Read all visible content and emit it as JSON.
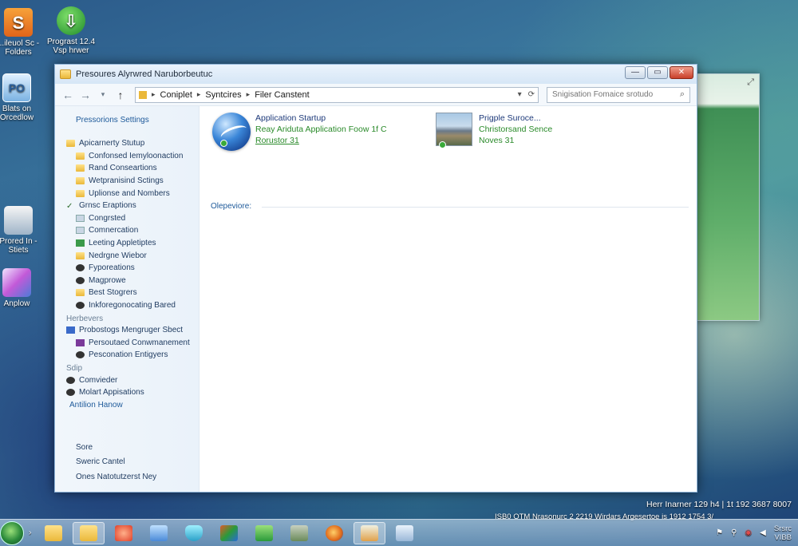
{
  "desktop": {
    "icons": [
      {
        "label_1": "...ileuol Sc -",
        "label_2": "Folders"
      },
      {
        "label_1": "Prograst 12.4",
        "label_2": "Vsp hrwer"
      },
      {
        "label_1": "Blats on",
        "label_2": "Orcedlow",
        "glyph": "PO"
      },
      {
        "label_1": "Prored In -",
        "label_2": "Stiets"
      },
      {
        "label_1": "Anplow",
        "label_2": ""
      }
    ]
  },
  "window": {
    "title": "Presoures Alyrwred Naruborbeutuc",
    "buttons": {
      "minimize": "—",
      "maximize": "▭",
      "close": "✕"
    }
  },
  "nav": {
    "back": "←",
    "forward": "→",
    "recent": "▾",
    "up": "↑",
    "address": [
      "Coniplet",
      "Syntcires",
      "Filer Canstent"
    ],
    "address_sep": "▸",
    "refresh": "⟳",
    "search_placeholder": "Snigisation Fomaice srotudo",
    "search_icon": "⌕"
  },
  "sidebar": {
    "heading": "Pressorions Settings",
    "tree": [
      {
        "label": "Apicarnerty Stutup",
        "icon": "folder",
        "level": 0
      },
      {
        "label": "Confonsed Iemyloonaction",
        "icon": "folder",
        "level": 1
      },
      {
        "label": "Rand Conseartions",
        "icon": "folder",
        "level": 1
      },
      {
        "label": "Wetpranisind Sctings",
        "icon": "folder",
        "level": 1
      },
      {
        "label": "Uplionse and Nombers",
        "icon": "folder",
        "level": 1
      },
      {
        "label": "Grnsc Eraptions",
        "icon": "check",
        "level": 0
      },
      {
        "label": "Congrsted",
        "icon": "doc",
        "level": 1
      },
      {
        "label": "Comnercation",
        "icon": "doc",
        "level": 1
      },
      {
        "label": "Leeting Appletiptes",
        "icon": "green",
        "level": 1
      },
      {
        "label": "Nedrgne Wiebor",
        "icon": "folder",
        "level": 1
      },
      {
        "label": "Fyporeations",
        "icon": "dark",
        "level": 1
      },
      {
        "label": "Magprowe",
        "icon": "dark",
        "level": 1
      },
      {
        "label": "Best Stogrers",
        "icon": "folder",
        "level": 1
      },
      {
        "label": "Inkforegonocating Bared",
        "icon": "dark",
        "level": 1
      },
      {
        "label": "Herbevers",
        "icon": "group",
        "level": 0
      },
      {
        "label": "Probostogs Mengruger Sbect",
        "icon": "blue",
        "level": 0
      },
      {
        "label": "Persoutaed Conwmanement",
        "icon": "purple",
        "level": 1
      },
      {
        "label": "Pesconation Entigyers",
        "icon": "dark",
        "level": 1
      },
      {
        "label": "Sdip",
        "icon": "group",
        "level": 0
      },
      {
        "label": "Comvieder",
        "icon": "dark",
        "level": 0
      },
      {
        "label": "Molart Appisations",
        "icon": "dark",
        "level": 0
      },
      {
        "label": "Antilion Hanow",
        "icon": "link",
        "level": 0
      }
    ],
    "bottom": [
      "Sore",
      "Sweric Cantel",
      "Ones Natotutzerst Ney"
    ]
  },
  "content": {
    "tiles": [
      {
        "title": "Application Startup",
        "line_2": "Reay Ariduta Application Foow 1f C",
        "line_3": "Rorustor 31"
      },
      {
        "title": "Prigple Suroce...",
        "line_2": "Christorsand Sence",
        "line_3": "Noves 31"
      }
    ],
    "section_label": "Olepeviore:"
  },
  "taskbar": {
    "arrow": "›",
    "status_text": "ISB0 OTM Nrasonurc  2  2219  Wirdars Argesertoe is 1912 1754 3/",
    "clock_line_1": "Herr Inarner 129 h4 | 1t 192 3687 8007",
    "tray_label": "Srsrc",
    "tray_sub": "VIBB"
  },
  "colors": {
    "accent_blue": "#1e5a9a",
    "link_green": "#2a8a2a",
    "close_red": "#c9402a"
  }
}
